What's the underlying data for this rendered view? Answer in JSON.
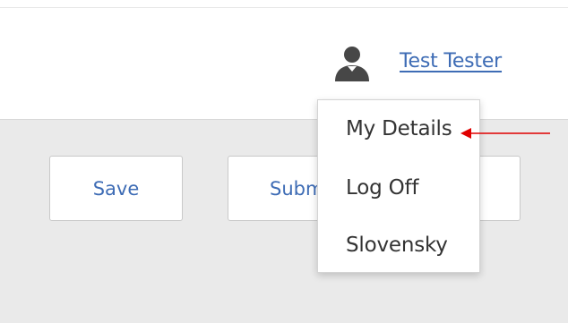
{
  "header": {
    "user_name": "Test Tester",
    "user_icon": "user-icon"
  },
  "toolbar": {
    "save_label": "Save",
    "submit_label": "Submit",
    "third_label": ""
  },
  "user_menu": {
    "items": [
      {
        "label": "My Details"
      },
      {
        "label": "Log Off"
      },
      {
        "label": "Slovensky"
      }
    ]
  },
  "colors": {
    "link": "#3e6cb5",
    "content_background": "#eaeaea",
    "annotation_arrow": "#e00000"
  }
}
